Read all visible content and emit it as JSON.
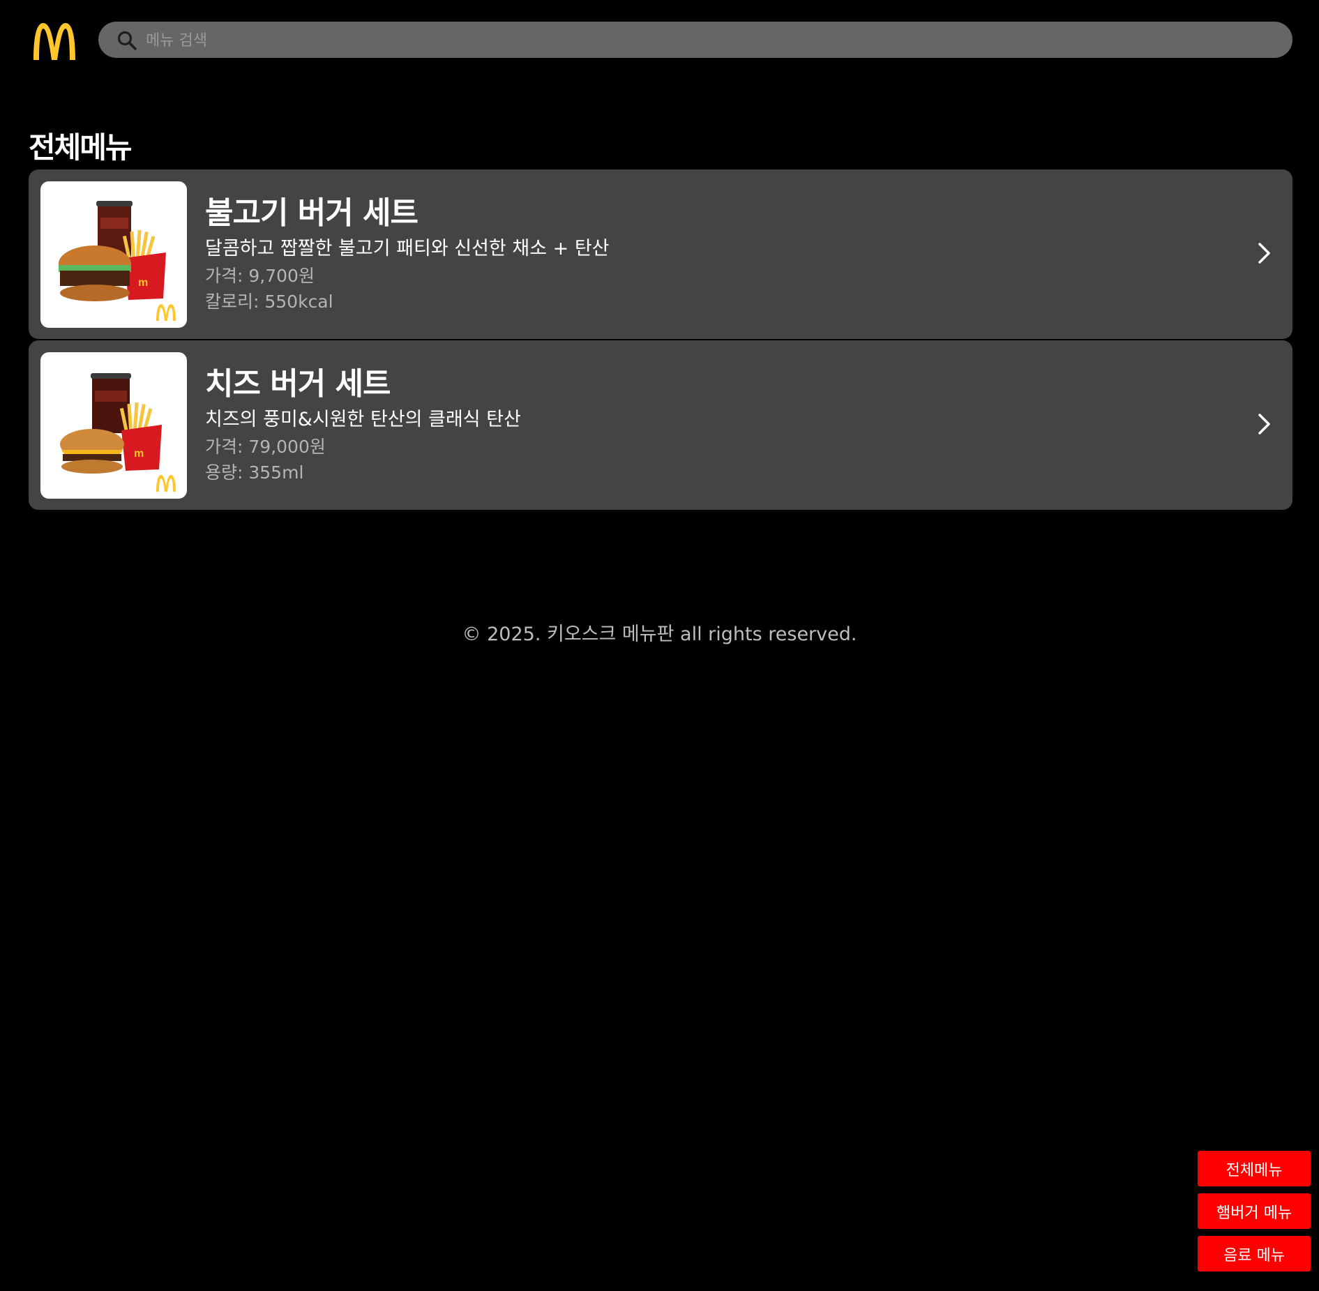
{
  "header": {
    "logo_icon": "mcdonalds-golden-arches-logo",
    "search": {
      "icon": "search-icon",
      "placeholder": "메뉴 검색",
      "value": ""
    }
  },
  "section_title": "전체메뉴",
  "menu_items": [
    {
      "name": "불고기 버거 세트",
      "description": "달콤하고 짭짤한 불고기 패티와 신선한 채소 + 탄산",
      "price": "가격: 9,700원",
      "extra": "칼로리: 550kcal",
      "image": "bulgogi-burger-set-image"
    },
    {
      "name": "치즈 버거 세트",
      "description": "치즈의 풍미&시원한 탄산의 클래식 탄산",
      "price": "가격: 79,000원",
      "extra": "용량: 355ml",
      "image": "cheese-burger-set-image"
    }
  ],
  "footer": "© 2025. 키오스크 메뉴판 all rights reserved.",
  "float_nav": [
    "전체메뉴",
    "햄버거 메뉴",
    "음료 메뉴"
  ],
  "colors": {
    "background": "#000000",
    "card": "#444444",
    "search": "#666666",
    "accent_red": "#ff0000",
    "logo_yellow": "#ffc72c"
  }
}
